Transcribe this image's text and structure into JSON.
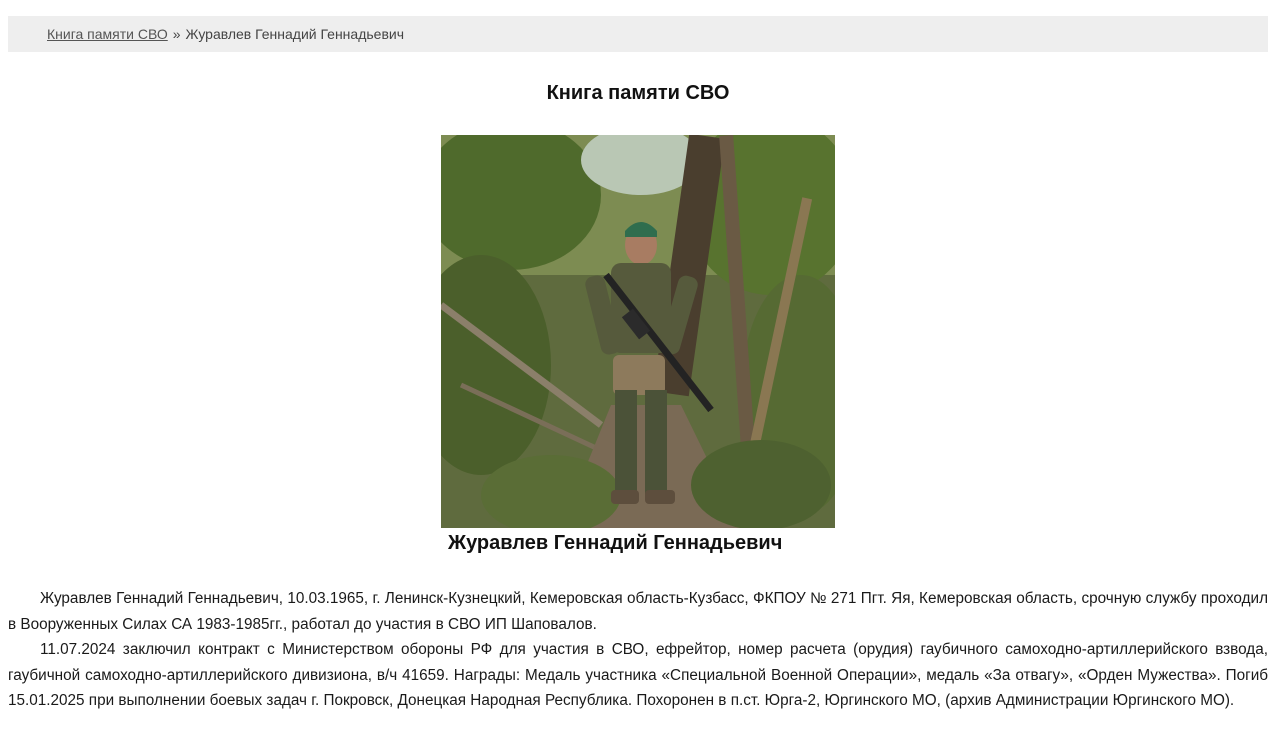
{
  "breadcrumb": {
    "link_label": "Книга памяти СВО",
    "separator": "»",
    "current": "Журавлев Геннадий Геннадьевич"
  },
  "page": {
    "title": "Книга памяти СВО"
  },
  "photo": {
    "caption": "Журавлев Геннадий Геннадьевич"
  },
  "bio": {
    "paragraphs": [
      "Журавлев Геннадий Геннадьевич, 10.03.1965, г. Ленинск-Кузнецкий, Кемеровская область-Кузбасс, ФКПОУ №  271 Пгт. Яя, Кемеровская область, срочную службу проходил в Вооруженных Силах СА 1983-1985гг., работал до участия в СВО ИП Шаповалов.",
      "11.07.2024 заключил контракт с Министерством обороны РФ для участия в СВО, ефрейтор, номер расчета (орудия) гаубичного самоходно-артиллерийского взвода, гаубичной самоходно-артиллерийского дивизиона, в/ч 41659. Награды: Медаль участника «Специальной Военной Операции», медаль «За отвагу», «Орден Мужества». Погиб 15.01.2025 при выполнении боевых задач г. Покровск, Донецкая Народная Республика. Похоронен в п.ст. Юрга-2, Юргинского МО, (архив Администрации Юргинского МО)."
    ]
  }
}
